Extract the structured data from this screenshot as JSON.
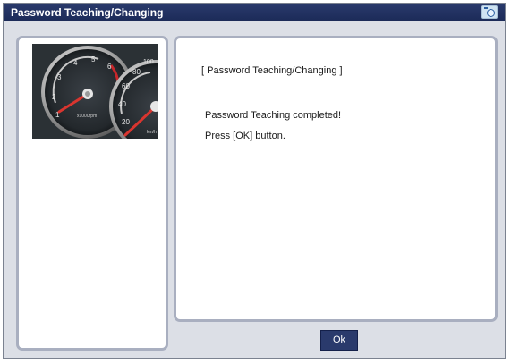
{
  "window": {
    "title": "Password Teaching/Changing",
    "title_icon": "camera-icon"
  },
  "left_panel": {
    "image": "instrument-cluster-photo",
    "tachometer_labels": [
      "1",
      "2",
      "3",
      "4",
      "5",
      "6",
      "x1000rpm"
    ],
    "speedometer_labels": [
      "20",
      "40",
      "60",
      "80",
      "100",
      "km/h"
    ]
  },
  "main": {
    "heading": "[ Password Teaching/Changing ]",
    "messages": [
      "Password Teaching completed!",
      "Press [OK] button."
    ]
  },
  "footer": {
    "ok_label": "Ok"
  },
  "colors": {
    "title_bar": "#1b2a57",
    "window_bg": "#dcdfe6",
    "panel_border": "#a9afc0",
    "ok_button": "#2a3a6c"
  }
}
